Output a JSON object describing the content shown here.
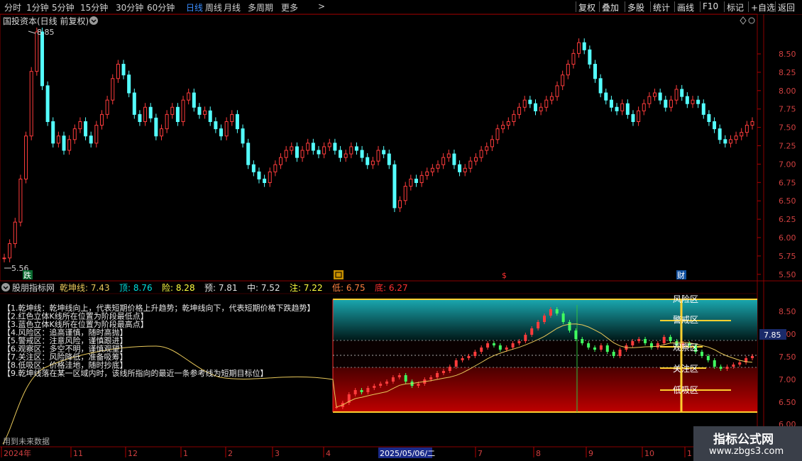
{
  "toolbar": {
    "tabs": [
      "分时",
      "1分钟",
      "5分钟",
      "15分钟",
      "30分钟",
      "60分钟",
      "日线",
      "周线",
      "月线",
      "多周期",
      "更多"
    ],
    "more_icon": "chevron-right-icon",
    "active_tab": "日线",
    "right_buttons": [
      "复权",
      "叠加",
      "多股",
      "统计",
      "画线",
      "F10",
      "标记",
      "+自选",
      "返回"
    ]
  },
  "main_chart": {
    "title": "国投资本(日线 前复权)",
    "dropdown_icon": "chevron-down-icon",
    "high_label": "8.85",
    "low_label": "5.56",
    "y_ticks": [
      "8.50",
      "8.25",
      "8.00",
      "7.75",
      "7.50",
      "7.25",
      "7.00",
      "6.75",
      "6.50",
      "6.25",
      "6.00",
      "5.75",
      "5.50"
    ],
    "markers": [
      "跌",
      "回",
      "$",
      "财"
    ]
  },
  "indicator_panel": {
    "name": "股朋指标网",
    "values": [
      {
        "label": "乾坤线:",
        "value": "7.43",
        "color": "#e8c85a"
      },
      {
        "label": "顶:",
        "value": "8.76",
        "color": "#00e0e0"
      },
      {
        "label": "险:",
        "value": "8.28",
        "color": "#ffff40"
      },
      {
        "label": "预:",
        "value": "7.81",
        "color": "#e0e0e0"
      },
      {
        "label": "中:",
        "value": "7.52",
        "color": "#e0e0e0"
      },
      {
        "label": "注:",
        "value": "7.22",
        "color": "#ffff40"
      },
      {
        "label": "低:",
        "value": "6.75",
        "color": "#ff8040"
      },
      {
        "label": "底:",
        "value": "6.27",
        "color": "#ff3030"
      }
    ],
    "notes": [
      "【1.乾坤线：乾坤线向上，代表短期价格上升趋势；乾坤线向下，代表短期价格下跌趋势】",
      "【2.红色立体K线所在位置为阶段最低点】",
      "【3.蓝色立体K线所在位置为阶段最高点】",
      "【4.风险区：追高谨慎，随时高抛】",
      "【5.警戒区：注意风险，谨慎跟进】",
      "【6.观察区：多空不明，谨慎观望】",
      "【7.关注区：风险降低，准备吸筹】",
      "【8.低吸区：价格洼地，随时抄底】",
      "【9.乾坤线落在某一区域内时，该线所指向的最近一条参考线为短期目标位】"
    ],
    "zones": [
      "风险区",
      "警戒区",
      "观察区",
      "关注区",
      "低吸区"
    ],
    "y_ticks": [
      "8.50",
      "8.00",
      "7.50",
      "7.00",
      "6.50",
      "6.00"
    ],
    "current_value_tag": "7.85",
    "future_data_note": "用到未来数据"
  },
  "time_axis": {
    "labels": [
      "2024年",
      "11",
      "12",
      "1",
      "2",
      "3",
      "4",
      "7",
      "8",
      "9",
      "10",
      "1"
    ],
    "selected_date": "2025/05/06/二"
  },
  "watermark": {
    "title": "指标公式网",
    "url": "www.zbgs3.com"
  },
  "colors": {
    "up": "#ff3c3c",
    "down": "#54ffff",
    "ma_line": "#e8c85a",
    "axis_red": "#b00000",
    "active_blue": "#3a8dff"
  },
  "chart_data": {
    "type": "candlestick",
    "series_count": 1,
    "price_range": [
      5.5,
      8.9
    ],
    "close_path": [
      5.7,
      5.9,
      6.2,
      6.8,
      7.4,
      8.3,
      8.85,
      8.1,
      7.6,
      7.3,
      7.4,
      7.2,
      7.35,
      7.5,
      7.6,
      7.4,
      7.3,
      7.55,
      7.7,
      7.9,
      8.2,
      8.4,
      8.25,
      8.0,
      7.7,
      7.6,
      7.8,
      7.65,
      7.4,
      7.5,
      7.7,
      7.8,
      7.6,
      7.9,
      8.0,
      7.8,
      7.7,
      7.75,
      7.6,
      7.5,
      7.4,
      7.6,
      7.7,
      7.5,
      7.3,
      7.0,
      6.9,
      6.8,
      6.75,
      6.9,
      7.0,
      7.1,
      7.2,
      7.25,
      7.1,
      7.2,
      7.3,
      7.2,
      7.15,
      7.25,
      7.3,
      7.2,
      7.1,
      7.15,
      7.25,
      7.2,
      7.1,
      7.0,
      7.05,
      7.2,
      7.15,
      7.0,
      6.4,
      6.5,
      6.7,
      6.8,
      6.75,
      6.85,
      6.9,
      6.95,
      7.0,
      7.1,
      7.15,
      7.0,
      6.9,
      6.95,
      7.05,
      7.1,
      7.2,
      7.25,
      7.35,
      7.5,
      7.55,
      7.6,
      7.7,
      7.8,
      7.9,
      7.85,
      7.75,
      7.8,
      7.9,
      7.95,
      8.1,
      8.25,
      8.4,
      8.55,
      8.7,
      8.6,
      8.4,
      8.2,
      8.0,
      7.9,
      7.8,
      7.75,
      7.85,
      7.7,
      7.6,
      7.75,
      7.85,
      7.95,
      8.0,
      7.9,
      7.8,
      7.9,
      8.05,
      7.95,
      7.85,
      7.9,
      7.85,
      7.7,
      7.6,
      7.5,
      7.35,
      7.3,
      7.35,
      7.4,
      7.45,
      7.55,
      7.6
    ]
  }
}
